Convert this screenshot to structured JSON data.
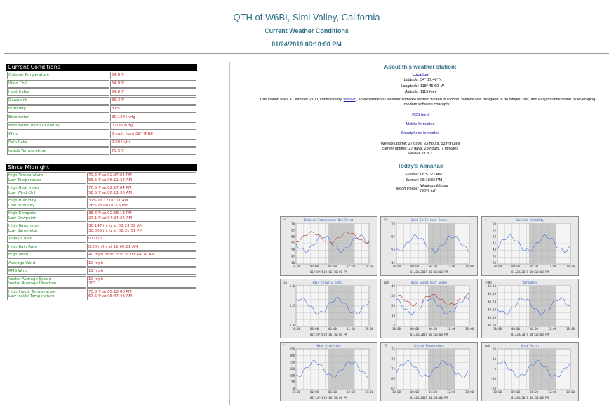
{
  "header": {
    "title": "QTH of W6BI, Simi Valley, California",
    "subtitle": "Current Weather Conditions",
    "timestamp": "01/24/2019 06:10:00 PM"
  },
  "current": {
    "heading": "Current Conditions",
    "rows": [
      {
        "label": "Outside Temperature",
        "value": "64.8°F"
      },
      {
        "label": "Wind Chill",
        "value": "64.8°F"
      },
      {
        "label": "Heat Index",
        "value": "64.8°F"
      },
      {
        "label": "Dewpoint",
        "value": "33.3°F"
      },
      {
        "label": "Humidity",
        "value": "31%"
      },
      {
        "label": "Barometer",
        "value": "30.124 inHg"
      },
      {
        "label": "Barometer Trend (3 hours)",
        "value": "0.030 inHg"
      },
      {
        "label": "Wind",
        "value": "3 mph from 32° (NNE)"
      },
      {
        "label": "Rain Rate",
        "value": "0.00 in/hr"
      },
      {
        "label": "Inside Temperature",
        "value": "73.5°F"
      }
    ]
  },
  "midnight": {
    "heading": "Since Midnight",
    "rows": [
      {
        "labels": [
          "High Temperature",
          "Low Temperature"
        ],
        "values": [
          "70.5°F at 02:27:04 PM",
          "58.5°F at 06:11:38 AM"
        ]
      },
      {
        "labels": [
          "High Heat Index",
          "Low Wind Chill"
        ],
        "values": [
          "70.5°F at 02:27:04 PM",
          "58.5°F at 06:11:38 AM"
        ]
      },
      {
        "labels": [
          "High Humidity",
          "Low Humidity"
        ],
        "values": [
          "37% at 12:00:01 AM",
          "26% at 04:00:16 PM"
        ]
      },
      {
        "labels": [
          "High Dewpoint",
          "Low Dewpoint"
        ],
        "values": [
          "35.6°F at 02:58:13 PM",
          "27.1°F at 04:24:22 AM"
        ]
      },
      {
        "labels": [
          "High Barometer",
          "Low Barometer"
        ],
        "values": [
          "30.147 inHg at 08:23:32 AM",
          "30.085 inHg at 02:31:51 PM"
        ]
      },
      {
        "labels": [
          "Today's Rain"
        ],
        "values": [
          "0.00 in"
        ]
      },
      {
        "labels": [
          "High Rain Rate"
        ],
        "values": [
          "0.00 in/hr at 12:00:01 AM"
        ]
      },
      {
        "labels": [
          "High Wind"
        ],
        "values": [
          "40 mph from 359° at 05:44:10 AM"
        ]
      },
      {
        "labels": [
          "Average Wind"
        ],
        "values": [
          "10 mph"
        ]
      },
      {
        "labels": [
          "RMS Wind"
        ],
        "values": [
          "11 mph"
        ]
      },
      {
        "labels": [
          "Vector Average Speed",
          "Vector Average Direction"
        ],
        "values": [
          "10 mph",
          "20°"
        ]
      },
      {
        "labels": [
          "High Inside Temperature",
          "Low Inside Temperature"
        ],
        "values": [
          "73.8°F at 05:10:00 PM",
          "67.5°F at 08:47:48 AM"
        ]
      }
    ]
  },
  "about": {
    "heading": "About this weather station:",
    "location_heading": "Location",
    "location": [
      {
        "k": "Latitude:",
        "v": "34° 17.40' N"
      },
      {
        "k": "Longitude:",
        "v": "118° 45.60' W"
      },
      {
        "k": "Altitude:",
        "v": "1115 feet"
      }
    ],
    "desc_pre": "This station uses a Ultimeter 2100, controlled by '",
    "desc_link": "weewx",
    "desc_post": "', an experimental weather software system written in Python. Weewx was designed to be simple, fast, and easy to understand by leveraging modern software concepts.",
    "links": [
      "RSS feed",
      "Mobile formatted",
      "Smartphone formatted"
    ],
    "uptime": [
      "Weewx uptime: 27 days, 23 hours, 53 minutes",
      "Server uptime: 27 days, 23 hours, 7 minutes",
      "weewx v3.8.2"
    ]
  },
  "almanac": {
    "heading": "Today's Almanac",
    "rows": [
      {
        "k": "Sunrise:",
        "v": "06:57:21 AM"
      },
      {
        "k": "Sunset:",
        "v": "05:18:55 PM"
      }
    ],
    "moon_label": "Moon Phase:",
    "moon_value": [
      "Waning gibbous",
      "(90% full)"
    ]
  },
  "plots": [
    {
      "title": "Outside Temperature Dew Point",
      "unit": "°F",
      "yticks": [
        "70",
        "65",
        "60",
        "55",
        "50",
        "45",
        "40"
      ]
    },
    {
      "title": "Wind Chill  Heat Index",
      "unit": "°F",
      "yticks": [
        "75",
        "65",
        "55",
        "45"
      ]
    },
    {
      "title": "Outside Humidity",
      "unit": "%",
      "yticks": [
        "60",
        "55",
        "50",
        "45",
        "40",
        "35",
        "30"
      ]
    },
    {
      "title": "Rain (hourly total)",
      "unit": "in",
      "yticks": [
        "1.0",
        "0.5",
        "0.0"
      ]
    },
    {
      "title": "Wind Speed  Gust Speed",
      "unit": "mph",
      "yticks": [
        "40",
        "30",
        "20",
        "10",
        "0"
      ]
    },
    {
      "title": "Barometer",
      "unit": "inHg",
      "yticks": [
        "30.18",
        "30.16",
        "30.14",
        "30.12",
        "30.10",
        "30.08"
      ]
    },
    {
      "title": "Wind Direction",
      "unit": "°",
      "yticks": [
        "350",
        "300",
        "250",
        "150",
        "100",
        "50",
        "0"
      ]
    },
    {
      "title": "Inside Temperature",
      "unit": "°F",
      "yticks": [
        "75",
        "73",
        "71",
        "69",
        "67"
      ]
    },
    {
      "title": "Wind Vector",
      "unit": "mph",
      "yticks": [
        "20",
        "10",
        "0",
        "-10",
        "-20"
      ]
    }
  ],
  "plot_xticks": [
    "18:00",
    "00:00",
    "06:00",
    "12:00",
    "18:00"
  ],
  "plot_date": "01/24/2019 06:10:00 PM",
  "colors": {
    "heading": "#2d6e86",
    "label": "#2a8a2a",
    "value": "#c23030",
    "series_blue": "#3a6fd8",
    "series_red": "#b83030"
  }
}
